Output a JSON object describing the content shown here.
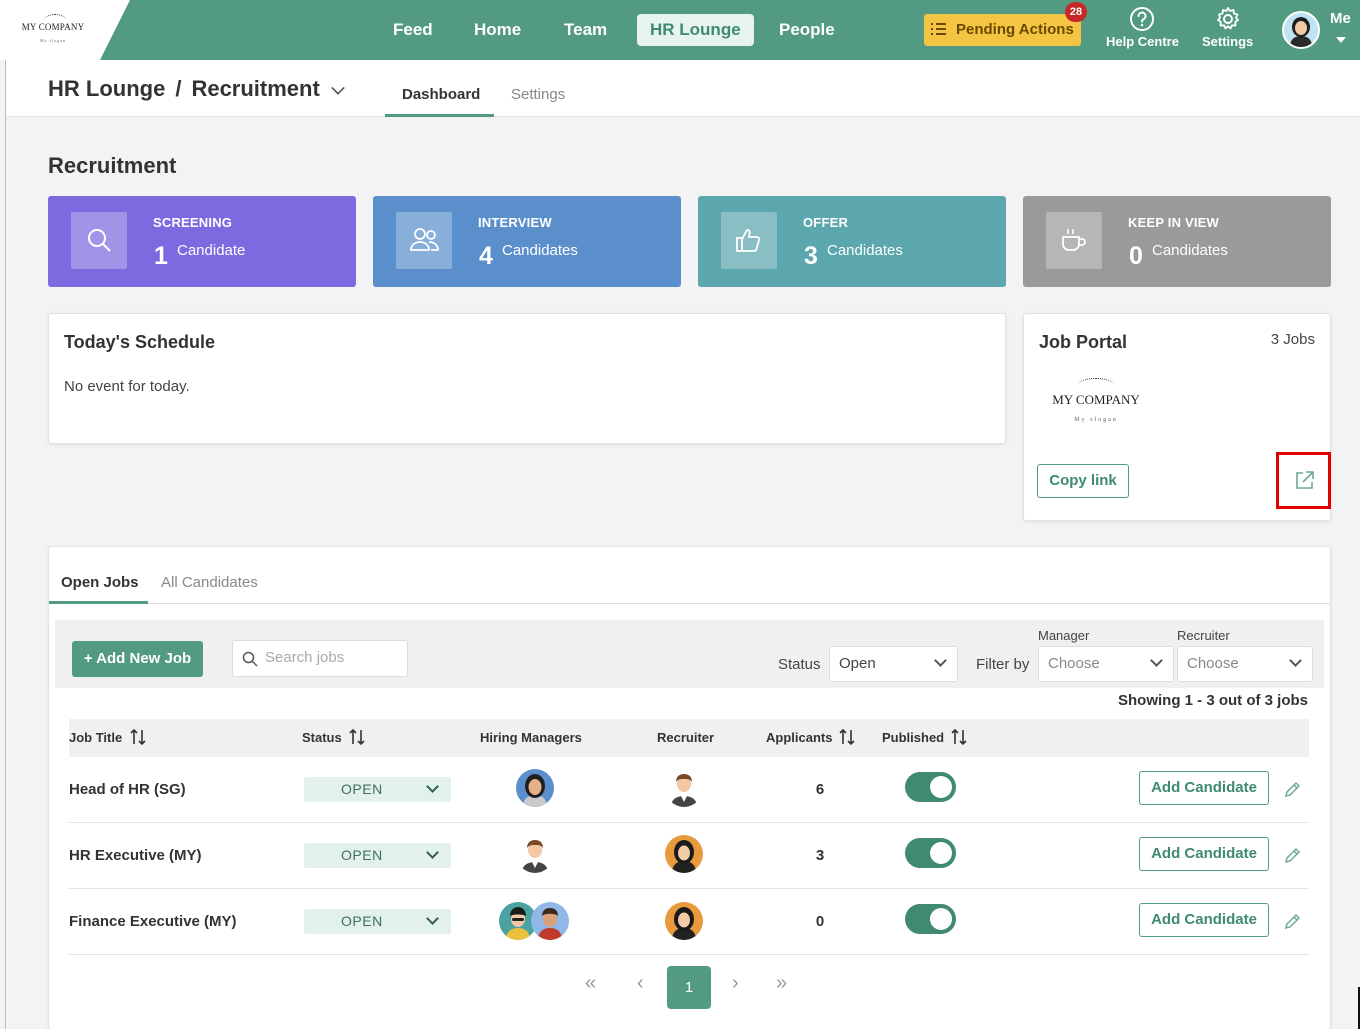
{
  "brand": {
    "name": "MY COMPANY",
    "slogan": "My slogan"
  },
  "nav": {
    "items": [
      "Feed",
      "Home",
      "Team",
      "HR Lounge",
      "People"
    ],
    "active": "HR Lounge",
    "pending_label": "Pending Actions",
    "pending_count": "28",
    "help_label": "Help Centre",
    "settings_label": "Settings",
    "me_label": "Me"
  },
  "breadcrumb": {
    "root": "HR Lounge",
    "sep": "/",
    "current": "Recruitment"
  },
  "subtabs": [
    "Dashboard",
    "Settings"
  ],
  "page_title": "Recruitment",
  "stats": [
    {
      "label": "SCREENING",
      "count": "1",
      "unit": "Candidate",
      "color": "#7c6be0",
      "icon": "search-icon"
    },
    {
      "label": "INTERVIEW",
      "count": "4",
      "unit": "Candidates",
      "color": "#5b8fcc",
      "icon": "users-icon"
    },
    {
      "label": "OFFER",
      "count": "3",
      "unit": "Candidates",
      "color": "#5ca6ad",
      "icon": "thumbs-up-icon"
    },
    {
      "label": "KEEP IN VIEW",
      "count": "0",
      "unit": "Candidates",
      "color": "#9a9a9a",
      "icon": "coffee-cup-icon"
    }
  ],
  "schedule": {
    "title": "Today's Schedule",
    "empty": "No event for today."
  },
  "job_portal": {
    "title": "Job Portal",
    "count": "3 Jobs",
    "copy_label": "Copy link"
  },
  "jobs": {
    "tabs": [
      "Open Jobs",
      "All Candidates"
    ],
    "add_label": "+ Add New Job",
    "search_placeholder": "Search jobs",
    "status_label": "Status",
    "status_value": "Open",
    "filter_label": "Filter by",
    "manager_label": "Manager",
    "manager_value": "Choose",
    "recruiter_label": "Recruiter",
    "recruiter_value": "Choose",
    "showing": "Showing 1 - 3 out of 3 jobs",
    "columns": [
      "Job Title",
      "Status",
      "Hiring Managers",
      "Recruiter",
      "Applicants",
      "Published"
    ],
    "rows": [
      {
        "title": "Head of HR (SG)",
        "status": "OPEN",
        "applicants": "6",
        "add": "Add Candidate"
      },
      {
        "title": "HR Executive (MY)",
        "status": "OPEN",
        "applicants": "3",
        "add": "Add Candidate"
      },
      {
        "title": "Finance Executive (MY)",
        "status": "OPEN",
        "applicants": "0",
        "add": "Add Candidate"
      }
    ],
    "pagination": {
      "first": "«",
      "prev": "‹",
      "current": "1",
      "next": "›",
      "last": "»"
    }
  }
}
